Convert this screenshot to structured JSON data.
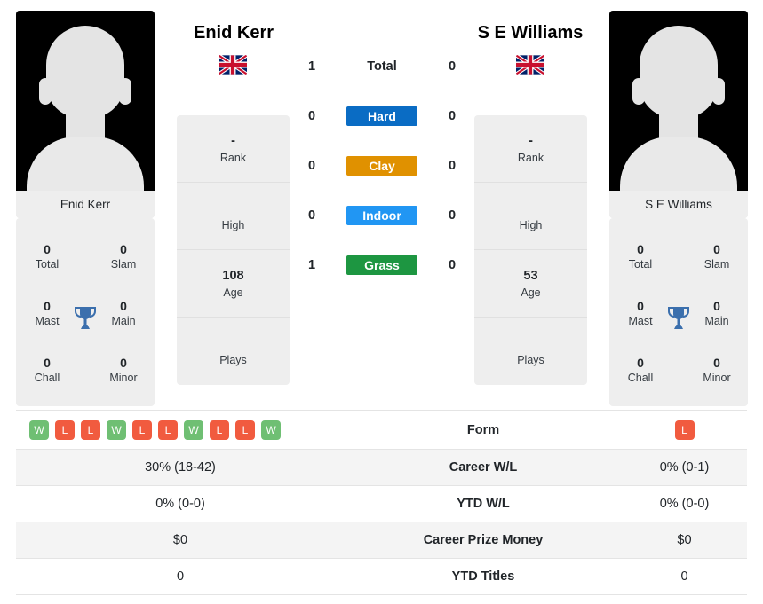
{
  "players": {
    "left": {
      "name": "Enid Kerr",
      "flag": "uk-flag-icon",
      "photo_alt": "player-silhouette",
      "rank": "-",
      "rank_label": "Rank",
      "high": "",
      "high_label": "High",
      "age": "108",
      "age_label": "Age",
      "plays": "",
      "plays_label": "Plays",
      "titles": {
        "total": "0",
        "total_label": "Total",
        "slam": "0",
        "slam_label": "Slam",
        "mast": "0",
        "mast_label": "Mast",
        "main": "0",
        "main_label": "Main",
        "chall": "0",
        "chall_label": "Chall",
        "minor": "0",
        "minor_label": "Minor"
      },
      "form": [
        "W",
        "L",
        "L",
        "W",
        "L",
        "L",
        "W",
        "L",
        "L",
        "W"
      ],
      "career_wl": "30% (18-42)",
      "ytd_wl": "0% (0-0)",
      "career_prize": "$0",
      "ytd_titles": "0"
    },
    "right": {
      "name": "S E Williams",
      "flag": "uk-flag-icon",
      "photo_alt": "player-silhouette",
      "rank": "-",
      "rank_label": "Rank",
      "high": "",
      "high_label": "High",
      "age": "53",
      "age_label": "Age",
      "plays": "",
      "plays_label": "Plays",
      "titles": {
        "total": "0",
        "total_label": "Total",
        "slam": "0",
        "slam_label": "Slam",
        "mast": "0",
        "mast_label": "Mast",
        "main": "0",
        "main_label": "Main",
        "chall": "0",
        "chall_label": "Chall",
        "minor": "0",
        "minor_label": "Minor"
      },
      "form": [
        "L"
      ],
      "career_wl": "0% (0-1)",
      "ytd_wl": "0% (0-0)",
      "career_prize": "$0",
      "ytd_titles": "0"
    }
  },
  "h2h": {
    "total": {
      "label": "Total",
      "left": "1",
      "right": "0"
    },
    "surfaces": [
      {
        "label": "Hard",
        "left": "0",
        "right": "0",
        "color": "#0a6cc4"
      },
      {
        "label": "Clay",
        "left": "0",
        "right": "0",
        "color": "#e09100"
      },
      {
        "label": "Indoor",
        "left": "0",
        "right": "0",
        "color": "#2196f3"
      },
      {
        "label": "Grass",
        "left": "1",
        "right": "0",
        "color": "#1d9641"
      }
    ]
  },
  "table": {
    "rows": [
      {
        "label": "Form",
        "left": "",
        "right": ""
      },
      {
        "label": "Career W/L",
        "left": "30% (18-42)",
        "right": "0% (0-1)"
      },
      {
        "label": "YTD W/L",
        "left": "0% (0-0)",
        "right": "0% (0-0)"
      },
      {
        "label": "Career Prize Money",
        "left": "$0",
        "right": "$0"
      },
      {
        "label": "YTD Titles",
        "left": "0",
        "right": "0"
      }
    ]
  },
  "colors": {
    "win": "#6fbf73",
    "loss": "#f15b3f",
    "trophy": "#3b6fad",
    "card_bg": "#eeeeee",
    "row_alt": "#f4f4f4"
  }
}
